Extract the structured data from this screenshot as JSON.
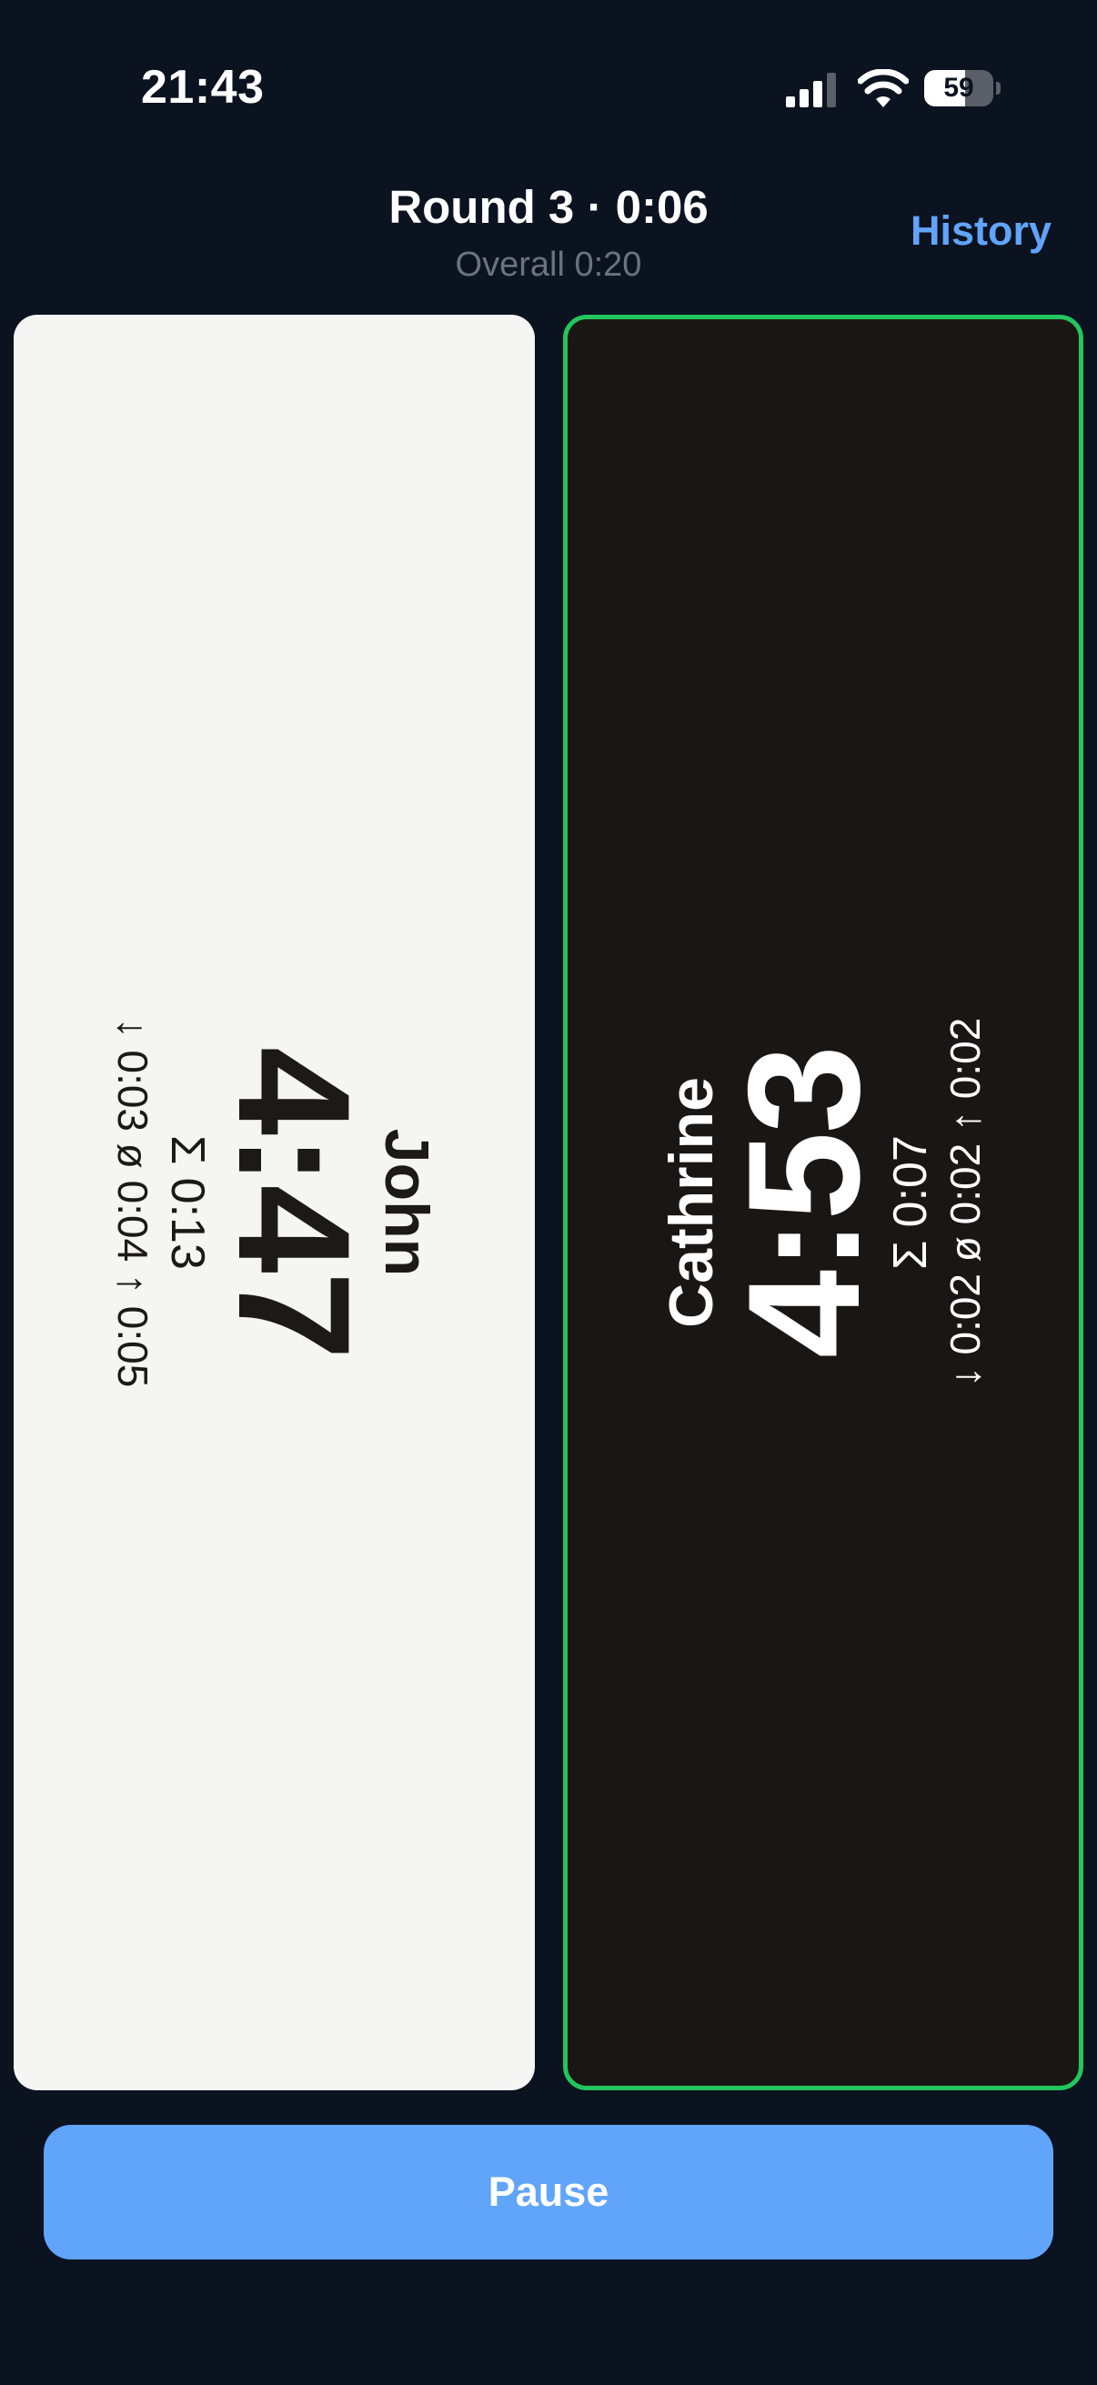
{
  "status_bar": {
    "time": "21:43",
    "battery_level": "59",
    "battery_fraction": 0.59,
    "icons": [
      "signal-icon",
      "wifi-icon",
      "battery-icon"
    ]
  },
  "header": {
    "round_title": "Round 3 · 0:06",
    "overall": "Overall 0:20",
    "history_label": "History"
  },
  "players": [
    {
      "name": "John",
      "clock": "4:47",
      "total": "Σ 0:13",
      "stats": "↓ 0:03  ø 0:04  ↑ 0:05",
      "active": false
    },
    {
      "name": "Cathrine",
      "clock": "4:53",
      "total": "Σ 0:07",
      "stats": "↓ 0:02  ø 0:02  ↑ 0:02",
      "active": true
    }
  ],
  "pause_label": "Pause",
  "colors": {
    "background": "#0b1220",
    "accent": "#60a5fa",
    "active_border": "#22c55e",
    "light_panel": "#f5f5f4",
    "dark_panel": "#1a1613"
  }
}
